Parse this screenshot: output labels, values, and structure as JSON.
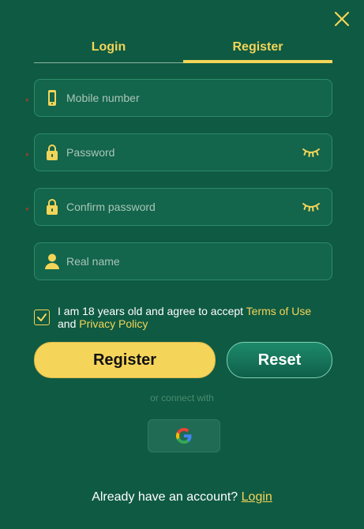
{
  "tabs": {
    "login": "Login",
    "register": "Register"
  },
  "fields": {
    "mobile": {
      "placeholder": "Mobile number",
      "icon": "phone-icon"
    },
    "password": {
      "placeholder": "Password",
      "icon": "lock-icon"
    },
    "confirm_password": {
      "placeholder": "Confirm password",
      "icon": "lock-icon"
    },
    "real_name": {
      "placeholder": "Real name",
      "icon": "user-icon"
    }
  },
  "agreement": {
    "text_prefix": "I am 18 years old and agree to accept ",
    "terms_link": "Terms of Use",
    "and_text": "and ",
    "privacy_link": "Privacy Policy",
    "checked": true
  },
  "buttons": {
    "register": "Register",
    "reset": "Reset"
  },
  "connect_text": "or connect with",
  "footer": {
    "text": "Already have an account? ",
    "login_link": "Login"
  },
  "colors": {
    "background": "#0f5a42",
    "accent": "#f3d559",
    "field_bg": "#13654b"
  }
}
